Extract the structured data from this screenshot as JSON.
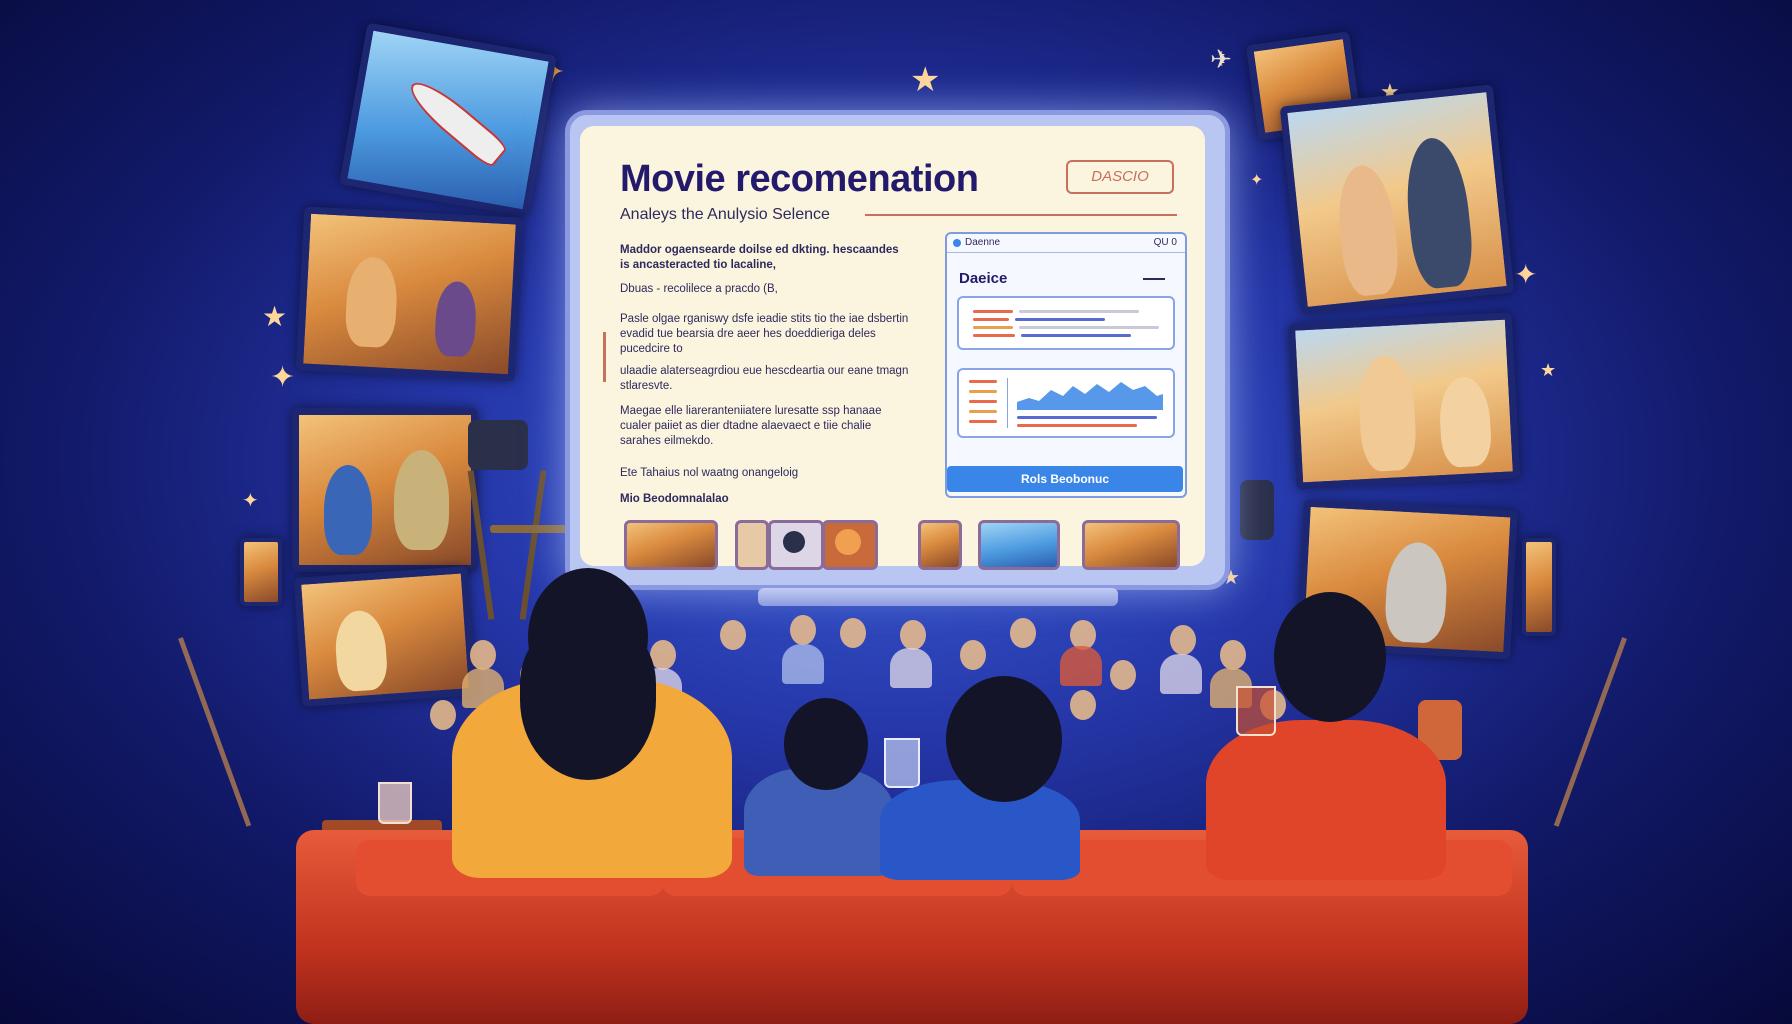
{
  "screen": {
    "title": "Movie recomenation",
    "stamp": "DASCIO",
    "subtitle": "Analeys the Anulysio Selence",
    "paragraphs": [
      "Maddor ogaensearde doilse ed dkting. hescaandes is ancasteracted tio lacaline,",
      "Dbuas - recolilece a pracdo (B,",
      "Pasle olgae rganiswy dsfe ieadie stits tio the iae dsbertin evadid tue bearsia dre aeer hes doeddieriga deles pucedcire to",
      "ulaadie alaterseagrdiou eue hescdeartia our eane tmagn stlaresvte.",
      "Maegae elle liareranteniiatere luresatte ssp hanaae cualer paiiet as dier dtadne alaevaect e tiie chalie sarahes eilmekdo."
    ],
    "footer_line": "Ete Tahaius nol waatng onangeloig",
    "footer_bold": "Mio Beodomnalalao",
    "panel": {
      "header_left": "Daenne",
      "header_right": "QU 0",
      "heading": "Daeice",
      "button": "Rols Beobonuc"
    }
  },
  "colors": {
    "screen_bg": "#fbf4df",
    "title": "#241a6b",
    "accent": "#c9705d",
    "button": "#3a86e8",
    "sofa": "#d8432a"
  }
}
